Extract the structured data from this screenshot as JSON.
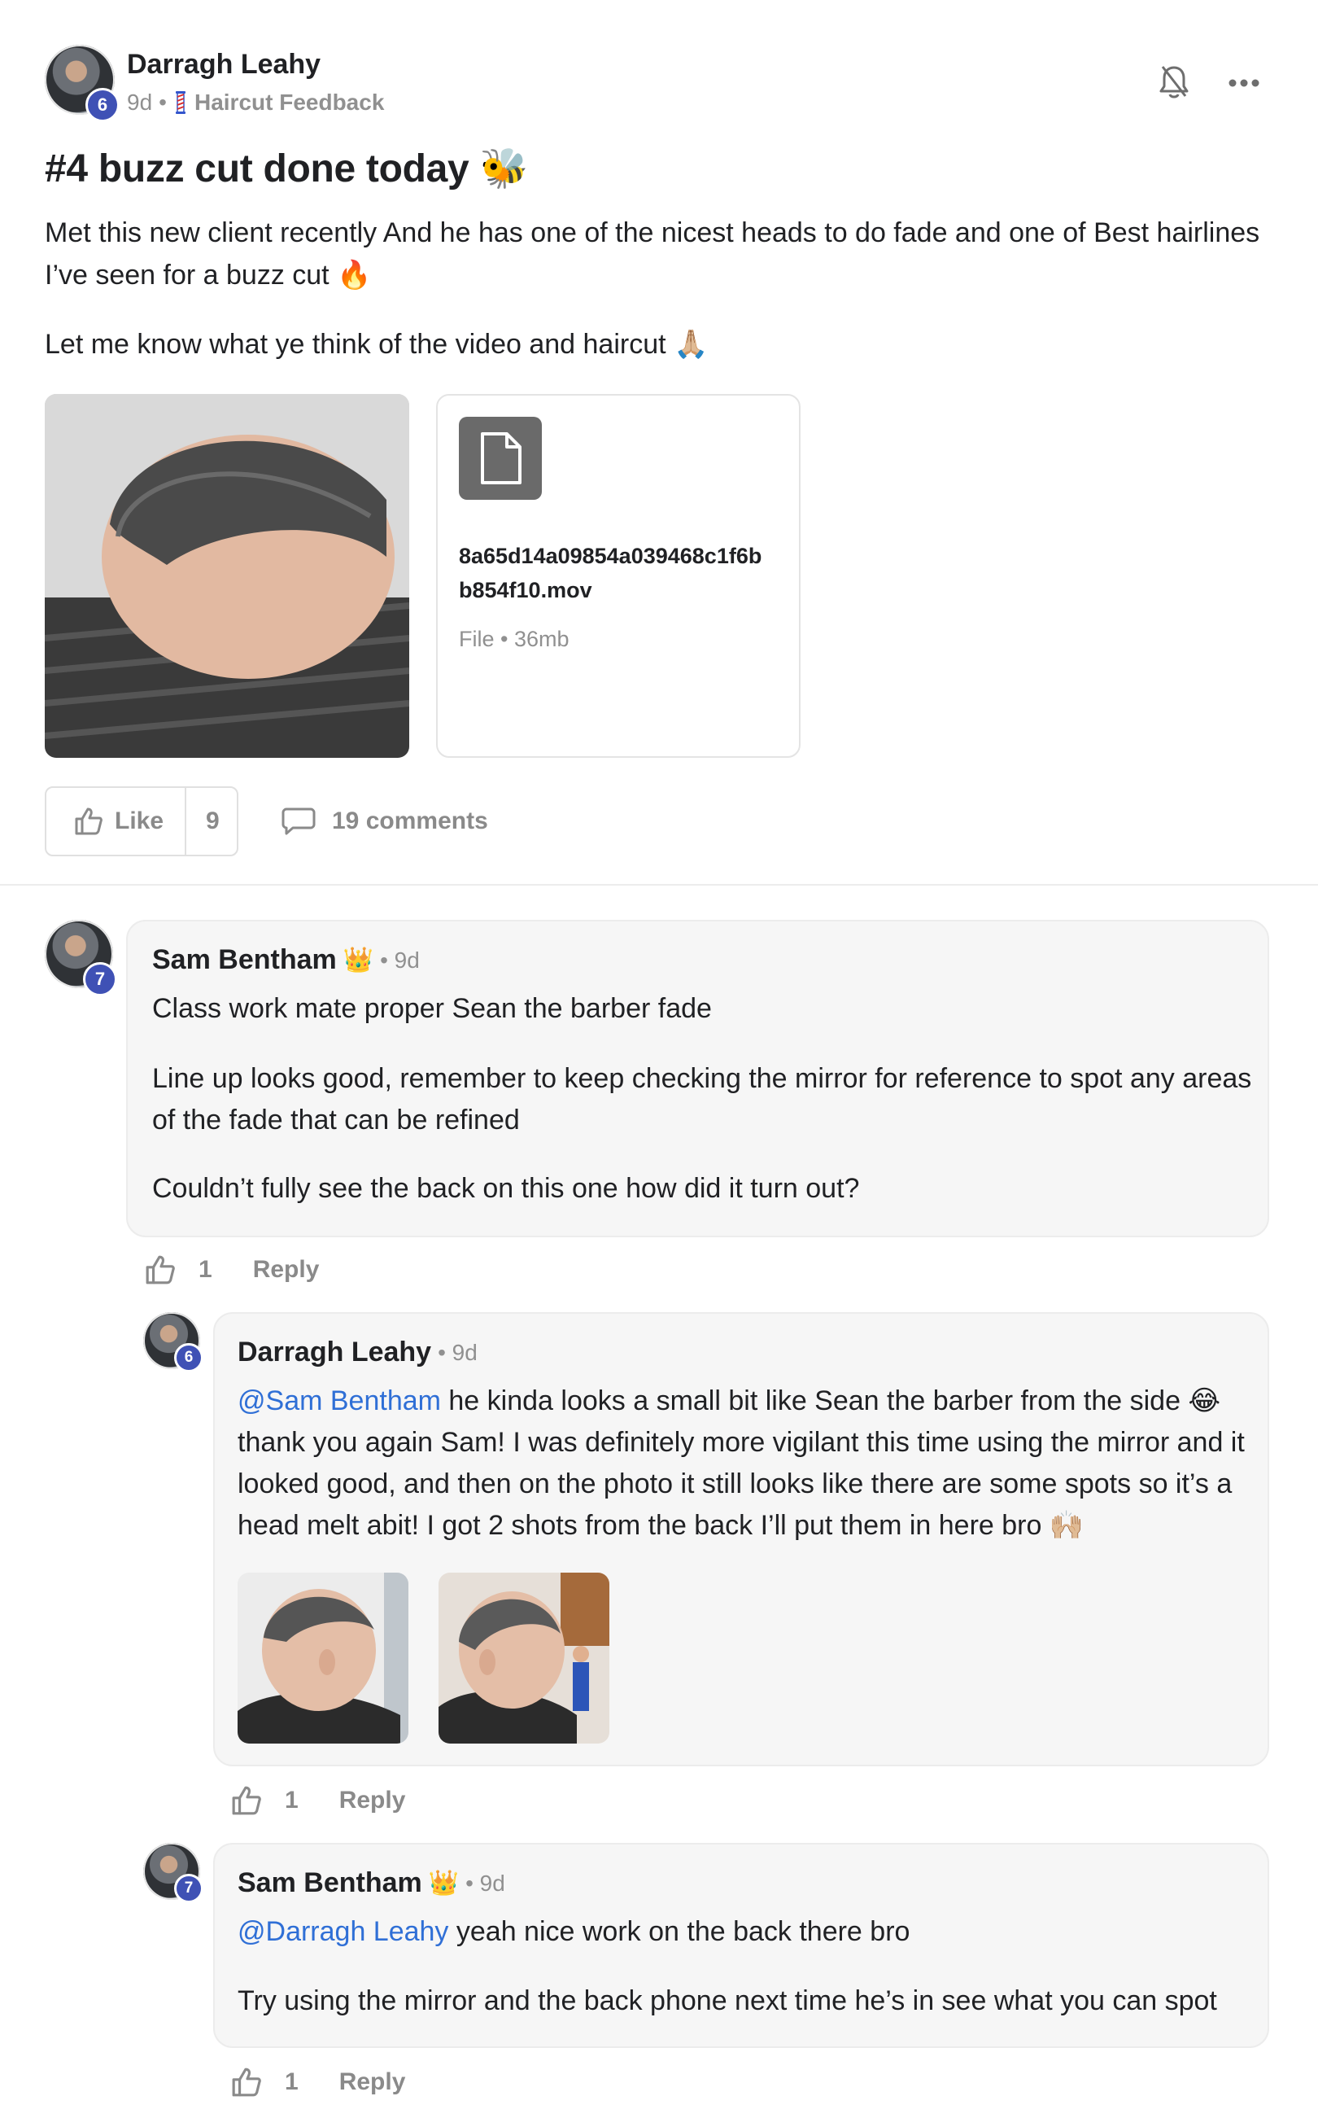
{
  "post": {
    "author": "Darragh Leahy",
    "author_level": "6",
    "age": "9d",
    "separator": "•",
    "category": "Haircut Feedback",
    "title": "#4 buzz cut done today 🐝",
    "body_line1": "Met this new client recently And he has one of the nicest heads to do fade and one of Best hairlines",
    "body_line2": "I’ve seen for a buzz cut 🔥",
    "body_line3": "Let me know what ye think of the video and haircut 🙏🏼",
    "attachment": {
      "filename_line1": "8a65d14a09854a039468c1f6b",
      "filename_line2": "b854f10.mov",
      "meta": "File • 36mb"
    },
    "like_label": "Like",
    "like_count": "9",
    "comments_label": "19 comments"
  },
  "comments": [
    {
      "author": "Sam Bentham",
      "crown": "👑",
      "level": "7",
      "age": "• 9d",
      "line1": "Class work mate proper Sean the barber fade",
      "line2": "Line up looks good, remember to keep checking the mirror for reference to spot any areas",
      "line3": "of the fade that can be refined",
      "line4": "Couldn’t fully see the back on this one how did it turn out?",
      "likes": "1",
      "reply_label": "Reply"
    },
    {
      "author": "Darragh Leahy",
      "level": "6",
      "age": "• 9d",
      "mention": "@Sam Bentham",
      "line1": " he kinda looks a small bit like Sean the barber from the side 😂",
      "line2": "thank you again Sam! I was definitely more vigilant this time using the mirror and it",
      "line3": "looked good, and then on the photo it still looks like there are some spots so it’s a",
      "line4": "head melt abit! I got 2 shots from the back I’ll put them in here bro 🙌🏼",
      "likes": "1",
      "reply_label": "Reply"
    },
    {
      "author": "Sam Bentham",
      "crown": "👑",
      "level": "7",
      "age": "• 9d",
      "mention": "@Darragh Leahy",
      "line1": " yeah nice work on the back there bro",
      "line2": "Try using the mirror and the back phone next time he’s in see what you can spot",
      "likes": "1",
      "reply_label": "Reply"
    }
  ],
  "icons": {
    "bell": "bell-off-icon",
    "more": "more-horizontal-icon",
    "like": "thumbs-up-icon",
    "comment": "comment-icon",
    "file": "file-icon",
    "category": "barber-pole-icon"
  },
  "colors": {
    "level_badge": "#3f51b5",
    "mention": "#2f6fd6",
    "muted": "#909090"
  }
}
